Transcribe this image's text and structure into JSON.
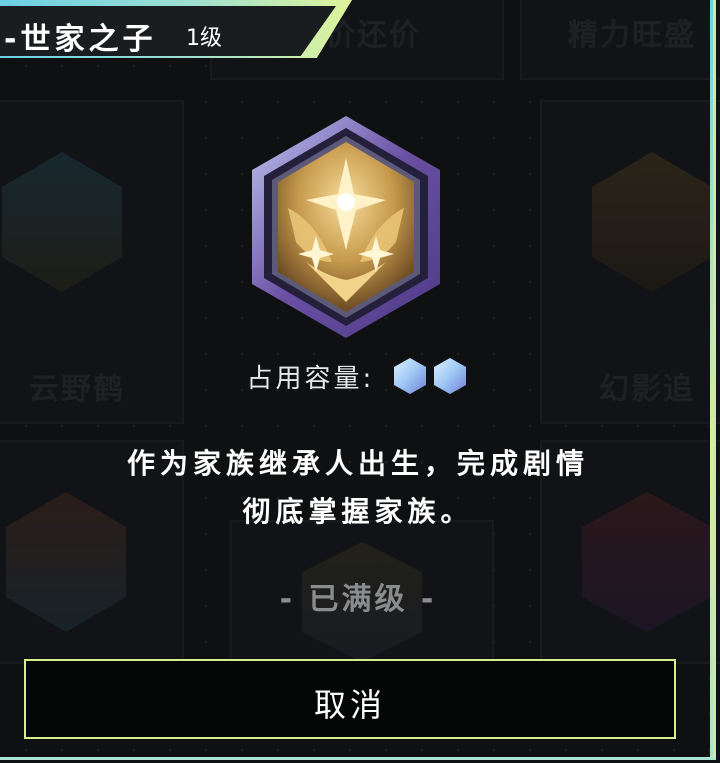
{
  "dialog": {
    "title": "-世家之子",
    "level": "1级",
    "capacity_label": "占用容量:",
    "capacity_gems": 2,
    "description_line1": "作为家族继承人出生，完成剧情",
    "description_line2": "彻底掌握家族。",
    "status": "- 已满级 -",
    "cancel_label": "取消"
  },
  "background_cards": [
    {
      "title": "讨价还价"
    },
    {
      "title": "精力旺盛"
    },
    {
      "title": "云野鹤"
    },
    {
      "title": "幻影追"
    }
  ],
  "colors": {
    "accent_cyan": "#6ad0e6",
    "accent_lime": "#dff49a",
    "gem": "#9fc8f4",
    "emblem_gold": "#d8b46a",
    "emblem_frame": "#7a5fb0"
  }
}
